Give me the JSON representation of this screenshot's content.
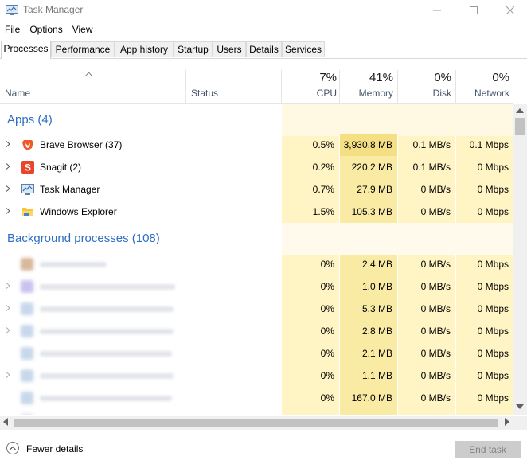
{
  "window": {
    "title": "Task Manager"
  },
  "menu": [
    "File",
    "Options",
    "View"
  ],
  "tabs": [
    "Processes",
    "Performance",
    "App history",
    "Startup",
    "Users",
    "Details",
    "Services"
  ],
  "columns": {
    "name": "Name",
    "status": "Status",
    "cpu": {
      "percent": "7%",
      "label": "CPU"
    },
    "memory": {
      "percent": "41%",
      "label": "Memory"
    },
    "disk": {
      "percent": "0%",
      "label": "Disk"
    },
    "network": {
      "percent": "0%",
      "label": "Network"
    }
  },
  "groups": {
    "apps": "Apps (4)",
    "background": "Background processes (108)"
  },
  "apps": [
    {
      "name": "Brave Browser (37)",
      "icon": "brave-icon",
      "cpu": "0.5%",
      "memory": "3,930.8 MB",
      "disk": "0.1 MB/s",
      "network": "0.1 Mbps"
    },
    {
      "name": "Snagit (2)",
      "icon": "snagit-icon",
      "cpu": "0.2%",
      "memory": "220.2 MB",
      "disk": "0.1 MB/s",
      "network": "0 Mbps"
    },
    {
      "name": "Task Manager",
      "icon": "task-manager-icon",
      "cpu": "0.7%",
      "memory": "27.9 MB",
      "disk": "0 MB/s",
      "network": "0 Mbps"
    },
    {
      "name": "Windows Explorer",
      "icon": "folder-icon",
      "cpu": "1.5%",
      "memory": "105.3 MB",
      "disk": "0 MB/s",
      "network": "0 Mbps"
    }
  ],
  "background": [
    {
      "cpu": "0%",
      "memory": "2.4 MB",
      "disk": "0 MB/s",
      "network": "0 Mbps"
    },
    {
      "cpu": "0%",
      "memory": "1.0 MB",
      "disk": "0 MB/s",
      "network": "0 Mbps"
    },
    {
      "cpu": "0%",
      "memory": "5.3 MB",
      "disk": "0 MB/s",
      "network": "0 Mbps"
    },
    {
      "cpu": "0%",
      "memory": "2.8 MB",
      "disk": "0 MB/s",
      "network": "0 Mbps"
    },
    {
      "cpu": "0%",
      "memory": "2.1 MB",
      "disk": "0 MB/s",
      "network": "0 Mbps"
    },
    {
      "cpu": "0%",
      "memory": "1.1 MB",
      "disk": "0 MB/s",
      "network": "0 Mbps"
    },
    {
      "cpu": "0%",
      "memory": "167.0 MB",
      "disk": "0 MB/s",
      "network": "0 Mbps"
    }
  ],
  "footer": {
    "fewer_details": "Fewer details",
    "end_task": "End task"
  },
  "colors": {
    "group_title": "#2e6fc3",
    "heat_light": "#fff9e3",
    "heat_medium": "#fff4c4",
    "heat_strong": "#f9eba4"
  }
}
